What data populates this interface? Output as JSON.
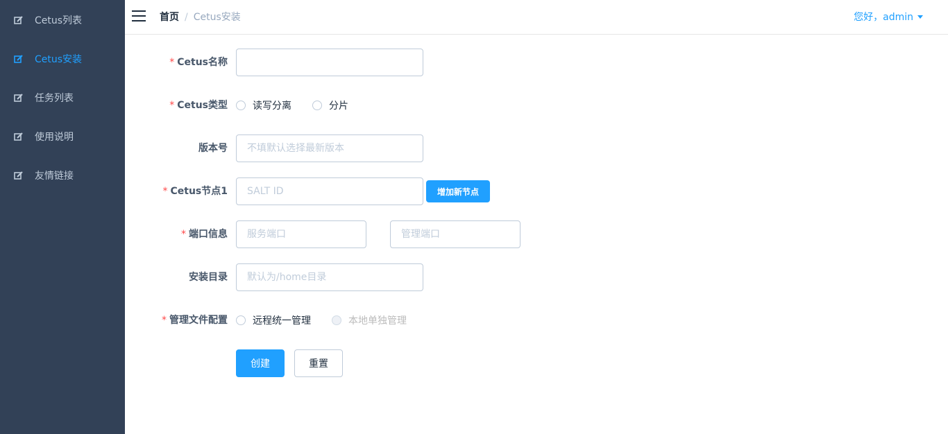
{
  "sidebar": {
    "items": [
      {
        "label": "Cetus列表",
        "icon": "edit-icon",
        "active": false
      },
      {
        "label": "Cetus安装",
        "icon": "edit-icon",
        "active": true
      },
      {
        "label": "任务列表",
        "icon": "edit-icon",
        "active": false
      },
      {
        "label": "使用说明",
        "icon": "edit-icon",
        "active": false
      },
      {
        "label": "友情链接",
        "icon": "edit-icon",
        "active": false
      }
    ]
  },
  "header": {
    "breadcrumb": {
      "home": "首页",
      "separator": "/",
      "current": "Cetus安装"
    },
    "user": "您好，admin"
  },
  "form": {
    "name": {
      "label": "Cetus名称",
      "required": true,
      "value": "",
      "placeholder": ""
    },
    "type": {
      "label": "Cetus类型",
      "required": true,
      "options": [
        "读写分离",
        "分片"
      ]
    },
    "version": {
      "label": "版本号",
      "required": false,
      "value": "",
      "placeholder": "不填默认选择最新版本"
    },
    "node": {
      "label": "Cetus节点1",
      "required": true,
      "value": "",
      "placeholder": "SALT ID",
      "add_button": "增加新节点"
    },
    "port": {
      "label": "端口信息",
      "required": true,
      "service_placeholder": "服务端口",
      "admin_placeholder": "管理端口"
    },
    "install_dir": {
      "label": "安装目录",
      "required": false,
      "value": "",
      "placeholder": "默认为/home目录"
    },
    "config": {
      "label": "管理文件配置",
      "required": true,
      "options": [
        "远程统一管理",
        "本地单独管理"
      ],
      "disabled_option": "本地单独管理"
    },
    "buttons": {
      "create": "创建",
      "reset": "重置"
    }
  },
  "colors": {
    "sidebar_bg": "#324157",
    "accent": "#20a0ff",
    "required": "#ff4949"
  }
}
